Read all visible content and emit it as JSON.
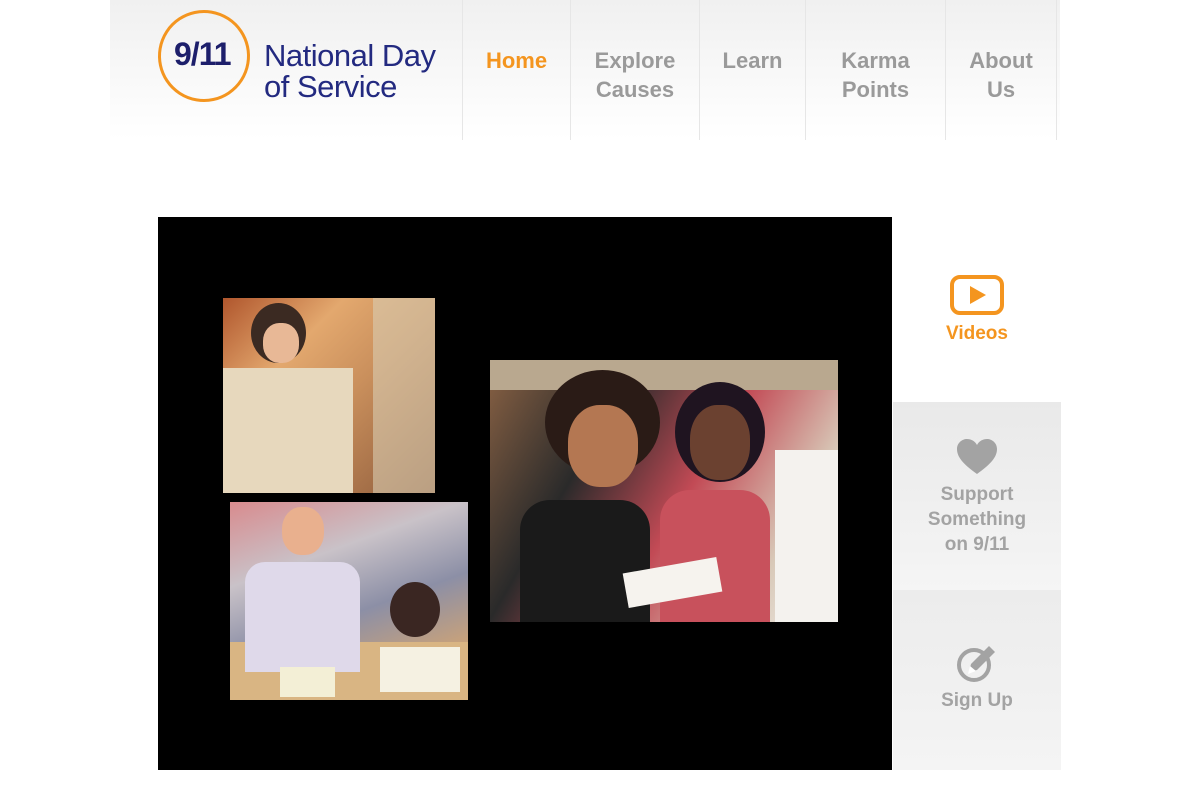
{
  "brand": {
    "logo_number": "9/11",
    "logo_text": "National Day\nof Service",
    "accent_color": "#f4951f",
    "brand_color": "#232a80"
  },
  "nav": {
    "items": [
      {
        "label": "Home",
        "active": true
      },
      {
        "label": "Explore\nCauses",
        "active": false
      },
      {
        "label": "Learn",
        "active": false
      },
      {
        "label": "Karma\nPoints",
        "active": false
      },
      {
        "label": "About\nUs",
        "active": false
      }
    ]
  },
  "sidebar": {
    "videos": {
      "label": "Videos",
      "icon": "play-icon"
    },
    "support": {
      "label": "Support\nSomething\non 9/11",
      "icon": "heart-icon"
    },
    "signup": {
      "label": "Sign Up",
      "icon": "pencil-icon"
    }
  },
  "video": {
    "photos": [
      "volunteer-carrying-box-photo",
      "volunteer-tutoring-children-photo",
      "volunteers-reading-book-photo"
    ]
  }
}
